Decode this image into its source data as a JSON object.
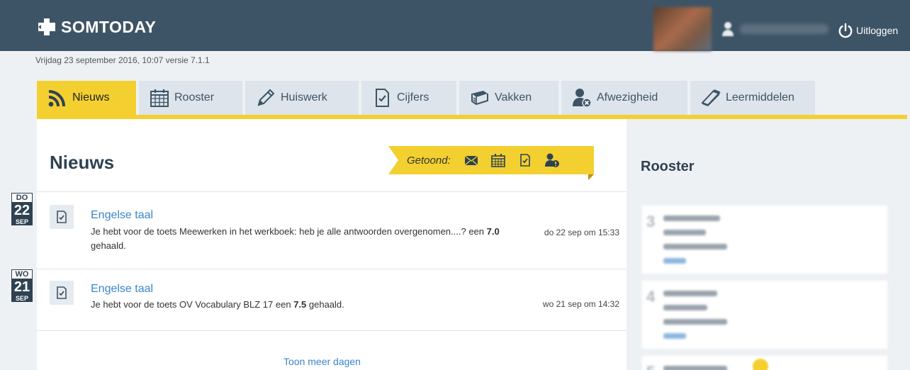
{
  "app": {
    "logo_text": "SOMTODAY",
    "logout_label": "Uitloggen"
  },
  "dateline": "Vrijdag 23 september 2016, 10:07 versie 7.1.1",
  "tabs": [
    {
      "label": "Nieuws",
      "icon": "rss-icon",
      "active": true
    },
    {
      "label": "Rooster",
      "icon": "calendar-icon"
    },
    {
      "label": "Huiswerk",
      "icon": "pencil-icon"
    },
    {
      "label": "Cijfers",
      "icon": "grade-check-icon"
    },
    {
      "label": "Vakken",
      "icon": "books-icon"
    },
    {
      "label": "Afwezigheid",
      "icon": "absence-user-icon"
    },
    {
      "label": "Leermiddelen",
      "icon": "book-icon"
    }
  ],
  "main": {
    "title": "Nieuws",
    "filter_label": "Getoond:",
    "filter_icons": [
      "envelope-icon",
      "calendar-icon",
      "grade-check-icon",
      "absence-user-icon"
    ],
    "news": [
      {
        "day_abbr": "DO",
        "day_num": "22",
        "month_abbr": "SEP",
        "title": "Engelse taal",
        "text_before": "Je hebt voor de toets Meewerken in het werkboek: heb je alle antwoorden overgenomen....? een ",
        "grade": "7.0",
        "text_after": " gehaald.",
        "time": "do 22 sep om 15:33"
      },
      {
        "day_abbr": "WO",
        "day_num": "21",
        "month_abbr": "SEP",
        "title": "Engelse taal",
        "text_before": "Je hebt voor de toets OV Vocabulary BLZ 17 een ",
        "grade": "7.5",
        "text_after": " gehaald.",
        "time": "wo 21 sep om 14:32"
      }
    ],
    "more_link": "Toon meer dagen"
  },
  "right": {
    "title": "Rooster"
  },
  "colors": {
    "topbar": "#3d5466",
    "accent": "#f3d030",
    "link": "#3a86c8"
  }
}
